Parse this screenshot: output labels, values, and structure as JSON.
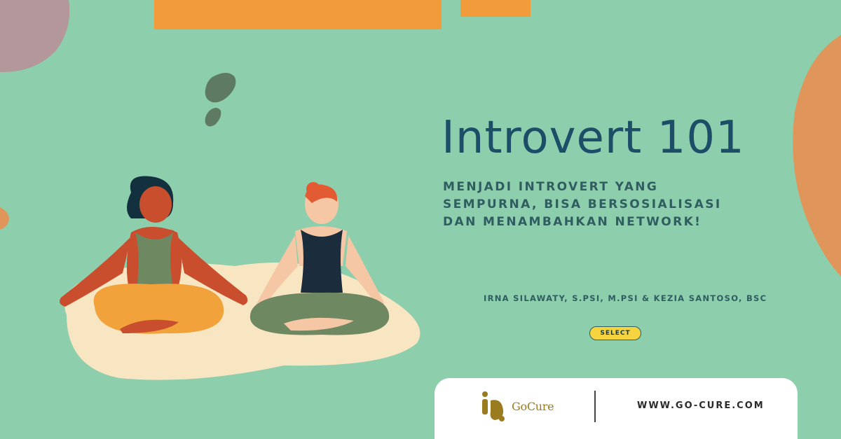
{
  "banner": {
    "title": "Introvert 101",
    "subtitle": "MENJADI INTROVERT YANG SEMPURNA, BISA BERSOSIALISASI DAN MENAMBAHKAN NETWORK!",
    "authors": "IRNA SILAWATY, S.PSI, M.PSI & KEZIA SANTOSO, BSC",
    "button_label": "SELECT"
  },
  "footer": {
    "brand_name": "GoCure",
    "website": "WWW.GO-CURE.COM"
  },
  "colors": {
    "background": "#8dcead",
    "title": "#1d4e68",
    "accent_orange": "#f19b3a",
    "button_yellow": "#f5d43f",
    "brand_gold": "#9a7b20"
  },
  "icons": [
    "gocure-logo-icon",
    "quote-mark-icon"
  ]
}
